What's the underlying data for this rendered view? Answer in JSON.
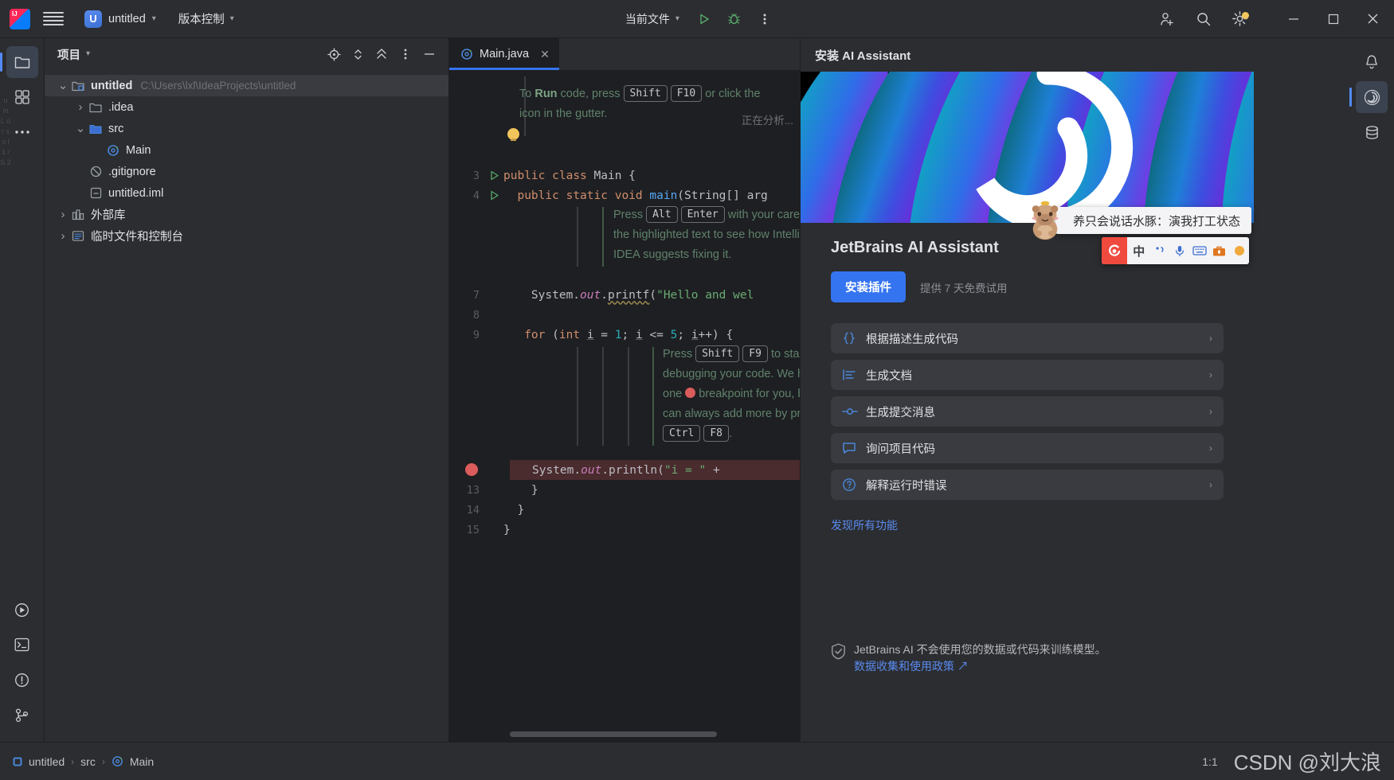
{
  "titlebar": {
    "logo_icon": "intellij-idea-logo",
    "menu_icon": "hamburger-menu-icon",
    "project_badge": "U",
    "project_name": "untitled",
    "vcs_label": "版本控制",
    "run_config": "当前文件",
    "run_icon": "run-play-icon",
    "debug_icon": "debug-bug-icon",
    "more_icon": "more-vertical-icon",
    "account_icon": "add-user-icon",
    "search_icon": "search-icon",
    "settings_icon": "gear-icon",
    "minimize_icon": "minimize-icon",
    "maximize_icon": "maximize-icon",
    "close_icon": "close-icon"
  },
  "left_rail": {
    "items": [
      {
        "name": "project-tool-icon",
        "label": "项目"
      },
      {
        "name": "commit-tool-icon",
        "label": "提交"
      },
      {
        "name": "more-tool-icon",
        "label": "更多"
      }
    ],
    "bottom_items": [
      {
        "name": "run-tool-icon",
        "label": "运行"
      },
      {
        "name": "terminal-tool-icon",
        "label": "终端"
      },
      {
        "name": "problems-tool-icon",
        "label": "问题"
      },
      {
        "name": "git-tool-icon",
        "label": "Git"
      }
    ]
  },
  "project_panel": {
    "title": "项目",
    "dropdown_icon": "chevron-down-icon",
    "actions": [
      {
        "name": "select-opened-file-icon"
      },
      {
        "name": "expand-collapse-icon"
      },
      {
        "name": "collapse-all-icon"
      },
      {
        "name": "options-menu-icon"
      },
      {
        "name": "hide-panel-icon"
      }
    ],
    "tree": [
      {
        "depth": 0,
        "arrow": "down",
        "icon": "project-folder-icon",
        "label": "untitled",
        "bold": true,
        "path": "C:\\Users\\lxl\\IdeaProjects\\untitled",
        "selected": true
      },
      {
        "depth": 1,
        "arrow": "right",
        "icon": "folder-icon",
        "label": ".idea",
        "bold": false,
        "path": "",
        "selected": false
      },
      {
        "depth": 1,
        "arrow": "down",
        "icon": "source-folder-icon",
        "label": "src",
        "bold": false,
        "path": "",
        "selected": false
      },
      {
        "depth": 2,
        "arrow": "none",
        "icon": "java-class-icon",
        "label": "Main",
        "bold": false,
        "path": "",
        "selected": false
      },
      {
        "depth": 1,
        "arrow": "none",
        "icon": "gitignore-icon",
        "label": ".gitignore",
        "bold": false,
        "path": "",
        "selected": false
      },
      {
        "depth": 1,
        "arrow": "none",
        "icon": "iml-file-icon",
        "label": "untitled.iml",
        "bold": false,
        "path": "",
        "selected": false
      },
      {
        "depth": 0,
        "arrow": "right",
        "icon": "external-libraries-icon",
        "label": "外部库",
        "bold": false,
        "path": "",
        "selected": false
      },
      {
        "depth": 0,
        "arrow": "right",
        "icon": "scratches-icon",
        "label": "临时文件和控制台",
        "bold": false,
        "path": "",
        "selected": false
      }
    ]
  },
  "editor": {
    "tab": {
      "label": "Main.java",
      "icon": "java-class-icon",
      "close_icon": "close-icon"
    },
    "analyzing_status": "正在分析...",
    "lines": [
      {
        "num": "3",
        "gutter": "run-play-icon",
        "code": "public class Main {"
      },
      {
        "num": "4",
        "gutter": "run-play-icon",
        "code": "    public static void main(String[] arg"
      },
      {
        "num": "7",
        "gutter": "",
        "code": "        System.out.printf(\"Hello and wel"
      },
      {
        "num": "8",
        "gutter": "",
        "code": ""
      },
      {
        "num": "9",
        "gutter": "",
        "code": "        for (int i = 1; i <= 5; i++) {"
      },
      {
        "num": "",
        "gutter": "breakpoint-icon",
        "code": "            System.out.println(\"i = \" + "
      },
      {
        "num": "13",
        "gutter": "",
        "code": "        }"
      },
      {
        "num": "14",
        "gutter": "",
        "code": "    }"
      },
      {
        "num": "15",
        "gutter": "",
        "code": "}"
      }
    ],
    "hints": [
      {
        "id": "run-hint",
        "icon": "lightbulb-icon",
        "line1_pre": "To ",
        "line1_bold": "Run",
        "line1_mid": " code, press ",
        "key1": "Shift",
        "key2": "F10",
        "line1_post": " or click the ",
        "line2": "icon in the gutter."
      },
      {
        "id": "alt-enter-hint",
        "line1_pre": "Press ",
        "key1": "Alt",
        "key2": "Enter",
        "line1_post": " with your caret at",
        "line2": "the highlighted text to see how IntelliJ",
        "line3": "IDEA suggests fixing it."
      },
      {
        "id": "debug-hint",
        "line1_pre": "Press ",
        "key1": "Shift",
        "key2": "F9",
        "line1_post": " to start",
        "line2": "debugging your code. We have set",
        "line3_pre": "one ",
        "line3_post": " breakpoint for you, but you",
        "line4": "can always add more by pressing",
        "key3": "Ctrl",
        "key4": "F8",
        "line5_post": "."
      }
    ]
  },
  "ai_panel": {
    "header_title": "安装 AI Assistant",
    "banner_icon": "jetbrains-ai-swirl-logo",
    "title": "JetBrains AI Assistant",
    "install_label": "安装插件",
    "trial_note": "提供 7 天免费试用",
    "features": [
      {
        "icon": "curly-braces-icon",
        "label": "根据描述生成代码",
        "arrow": "chevron-right-icon"
      },
      {
        "icon": "document-lines-icon",
        "label": "生成文档",
        "arrow": "chevron-right-icon"
      },
      {
        "icon": "commit-node-icon",
        "label": "生成提交消息",
        "arrow": "chevron-right-icon"
      },
      {
        "icon": "chat-bubble-icon",
        "label": "询问项目代码",
        "arrow": "chevron-right-icon"
      },
      {
        "icon": "question-circle-icon",
        "label": "解释运行时错误",
        "arrow": "chevron-right-icon"
      }
    ],
    "discover_link": "发现所有功能",
    "privacy_icon": "shield-check-icon",
    "privacy_text": "JetBrains AI 不会使用您的数据或代码来训练模型。",
    "policy_link": "数据收集和使用政策 ↗"
  },
  "right_rail": {
    "items": [
      {
        "name": "notifications-bell-icon"
      },
      {
        "name": "ai-assistant-icon"
      },
      {
        "name": "database-icon"
      }
    ]
  },
  "statusbar": {
    "breadcrumb": [
      {
        "icon": "module-icon",
        "label": "untitled"
      },
      {
        "icon": "",
        "label": "src"
      },
      {
        "icon": "java-class-icon",
        "label": "Main"
      }
    ],
    "separator": "›",
    "caret_position": "1:1",
    "watermark": "CSDN @刘大浪"
  },
  "ime": {
    "logo_icon": "sogou-ime-logo",
    "mode_label": "中",
    "buttons": [
      {
        "name": "punctuation-toggle-icon"
      },
      {
        "name": "microphone-icon"
      },
      {
        "name": "keyboard-icon"
      },
      {
        "name": "toolbox-icon"
      },
      {
        "name": "ime-menu-icon"
      }
    ]
  },
  "capybara_tip": {
    "icon": "capybara-mascot-icon",
    "text": "养只会说话水豚：演我打工状态"
  }
}
